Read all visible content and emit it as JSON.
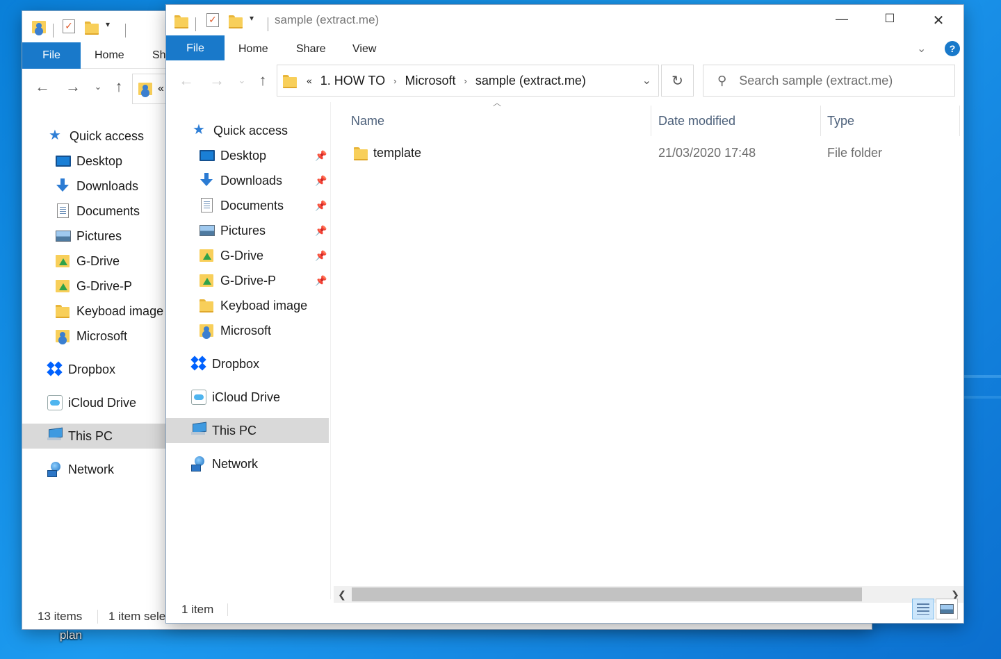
{
  "desktop": {
    "icon_label": "plan"
  },
  "back_window": {
    "tabs": [
      "File",
      "Home",
      "Sha"
    ],
    "address_chevron": "«",
    "nav": [
      {
        "label": "Quick access",
        "icon": "star-icon"
      },
      {
        "label": "Desktop",
        "icon": "desktop-icon"
      },
      {
        "label": "Downloads",
        "icon": "downloads-icon"
      },
      {
        "label": "Documents",
        "icon": "documents-icon"
      },
      {
        "label": "Pictures",
        "icon": "pictures-icon"
      },
      {
        "label": "G-Drive",
        "icon": "gdrive-icon"
      },
      {
        "label": "G-Drive-P",
        "icon": "gdrive-icon"
      },
      {
        "label": "Keyboad image",
        "icon": "folder-icon"
      },
      {
        "label": "Microsoft",
        "icon": "user-folder-icon"
      },
      {
        "label": "Dropbox",
        "icon": "dropbox-icon"
      },
      {
        "label": "iCloud Drive",
        "icon": "icloud-icon"
      },
      {
        "label": "This PC",
        "icon": "this-pc-icon"
      },
      {
        "label": "Network",
        "icon": "network-icon"
      }
    ],
    "status_items": "13 items",
    "status_selected": "1 item sele"
  },
  "main_window": {
    "title": "sample (extract.me)",
    "tabs": {
      "file": "File",
      "home": "Home",
      "share": "Share",
      "view": "View"
    },
    "help_label": "?",
    "breadcrumb": {
      "overflow": "«",
      "parts": [
        "1. HOW TO",
        "Microsoft",
        "sample (extract.me)"
      ]
    },
    "search": {
      "placeholder": "Search sample (extract.me)"
    },
    "nav": {
      "quick_access": "Quick access",
      "pinned": [
        {
          "label": "Desktop",
          "icon": "desktop-icon",
          "pinned": true
        },
        {
          "label": "Downloads",
          "icon": "downloads-icon",
          "pinned": true
        },
        {
          "label": "Documents",
          "icon": "documents-icon",
          "pinned": true
        },
        {
          "label": "Pictures",
          "icon": "pictures-icon",
          "pinned": true
        },
        {
          "label": "G-Drive",
          "icon": "gdrive-icon",
          "pinned": true
        },
        {
          "label": "G-Drive-P",
          "icon": "gdrive-icon",
          "pinned": true
        },
        {
          "label": "Keyboad image",
          "icon": "folder-icon",
          "pinned": false
        },
        {
          "label": "Microsoft",
          "icon": "user-folder-icon",
          "pinned": false
        }
      ],
      "dropbox": "Dropbox",
      "icloud": "iCloud Drive",
      "this_pc": "This PC",
      "network": "Network"
    },
    "columns": {
      "name": "Name",
      "date": "Date modified",
      "type": "Type"
    },
    "files": [
      {
        "name": "template",
        "date": "21/03/2020 17:48",
        "type": "File folder"
      }
    ],
    "status": "1 item"
  },
  "colors": {
    "accent": "#1979ca",
    "selection": "#d9d9d9",
    "desktop": "#1d9bf0"
  }
}
